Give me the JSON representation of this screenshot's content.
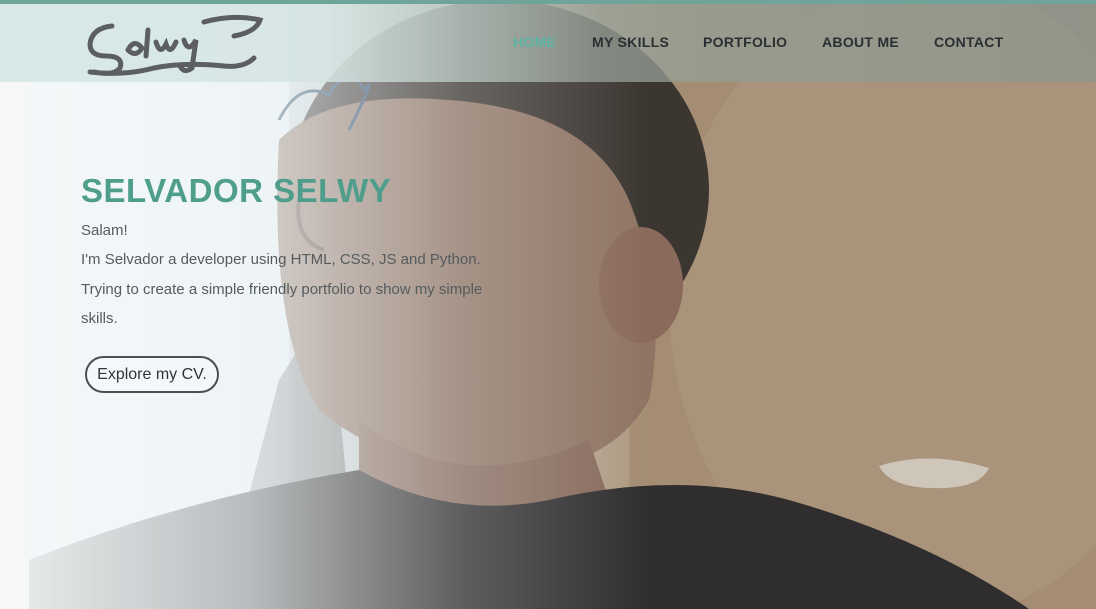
{
  "header": {
    "logo_text": "Selwy",
    "nav": [
      {
        "label": "HOME",
        "active": true
      },
      {
        "label": "MY SKILLS",
        "active": false
      },
      {
        "label": "PORTFOLIO",
        "active": false
      },
      {
        "label": "ABOUT ME",
        "active": false
      },
      {
        "label": "CONTACT",
        "active": false
      }
    ]
  },
  "hero": {
    "title": "SELVADOR SELWY",
    "greeting": "Salam!",
    "line1": "I'm Selvador a developer using HTML, CSS, JS and Python.",
    "line2": "Trying to create a simple friendly portfolio to show my simple",
    "line3": "skills.",
    "cta_label": "Explore my CV."
  },
  "colors": {
    "accent": "#5cb5a3",
    "title": "#4f9e8c",
    "nav_text": "#2a2f33",
    "header_top_border": "#6fa49b"
  }
}
